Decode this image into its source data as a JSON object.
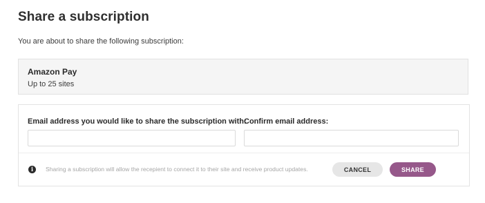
{
  "page": {
    "title": "Share a subscription",
    "intro": "You are about to share the following subscription:"
  },
  "subscription": {
    "name": "Amazon Pay",
    "detail": "Up to 25 sites"
  },
  "form": {
    "email_label": "Email address you would like to share the subscription with:",
    "email_value": "",
    "confirm_label": "Confirm email address:",
    "confirm_value": ""
  },
  "footer": {
    "info_icon": "info-icon",
    "notice": "Sharing a subscription will allow the recepient to connect it to their site and receive product updates.",
    "cancel_label": "CANCEL",
    "share_label": "SHARE"
  },
  "colors": {
    "accent": "#96588a",
    "cancel_bg": "#e6e6e6",
    "card_bg": "#f5f5f5",
    "notice_text": "#a6a6a6"
  }
}
